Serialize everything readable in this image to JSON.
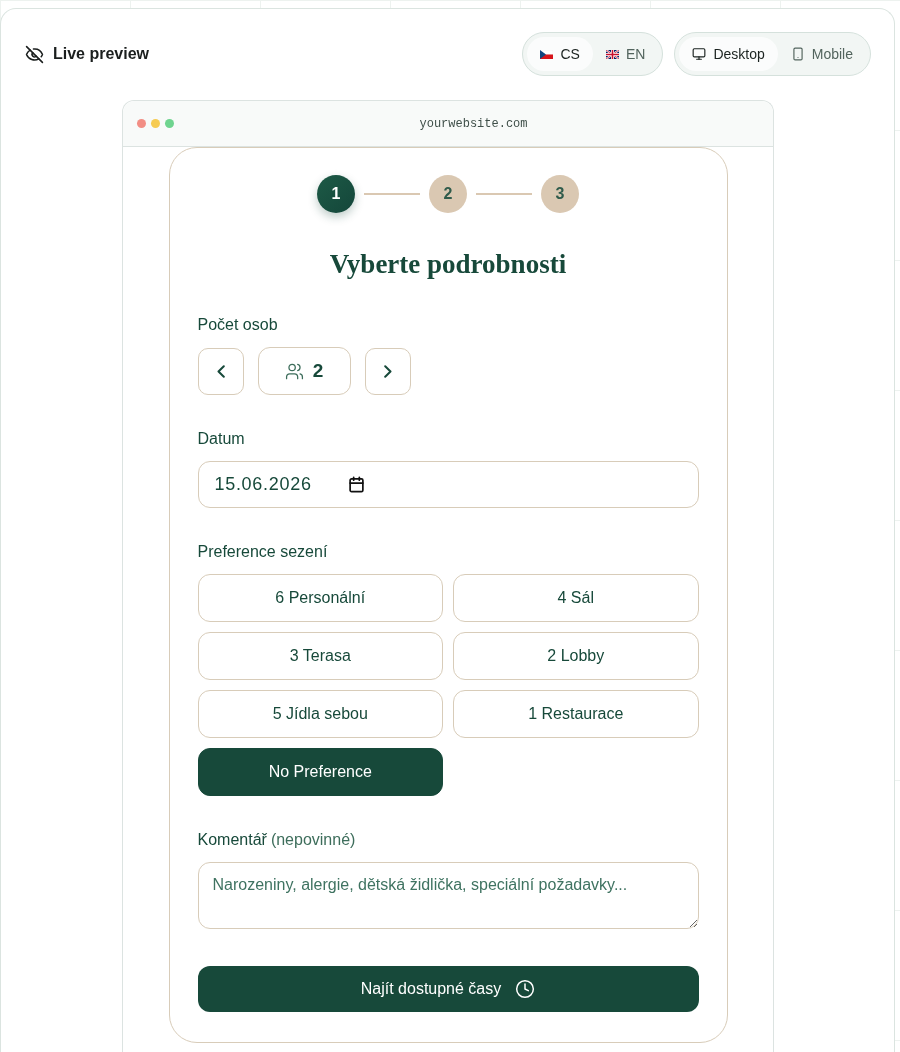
{
  "header": {
    "title": "Live preview",
    "languages": [
      {
        "label": "CS",
        "selected": true
      },
      {
        "label": "EN",
        "selected": false
      }
    ],
    "devices": [
      {
        "label": "Desktop",
        "selected": true
      },
      {
        "label": "Mobile",
        "selected": false
      }
    ]
  },
  "browser": {
    "url": "yourwebsite.com"
  },
  "form": {
    "steps": [
      {
        "label": "1",
        "selected": true
      },
      {
        "label": "2",
        "selected": false
      },
      {
        "label": "3",
        "selected": false
      }
    ],
    "title": "Vyberte podrobnosti",
    "guests": {
      "label": "Počet osob",
      "value": "2"
    },
    "date": {
      "label": "Datum",
      "value": "15.06.2026"
    },
    "seating": {
      "label": "Preference sezení",
      "options": [
        {
          "label": "6 Personální",
          "selected": false
        },
        {
          "label": "4 Sál",
          "selected": false
        },
        {
          "label": "3 Terasa",
          "selected": false
        },
        {
          "label": "2 Lobby",
          "selected": false
        },
        {
          "label": "5 Jídla sebou",
          "selected": false
        },
        {
          "label": "1 Restaurace",
          "selected": false
        },
        {
          "label": "No Preference",
          "selected": true
        }
      ]
    },
    "comment": {
      "label": "Komentář",
      "hint": "(nepovinné)",
      "placeholder": "Narozeniny, alergie, dětská židlička, speciální požadavky..."
    },
    "submit": {
      "label": "Najít dostupné časy"
    }
  }
}
